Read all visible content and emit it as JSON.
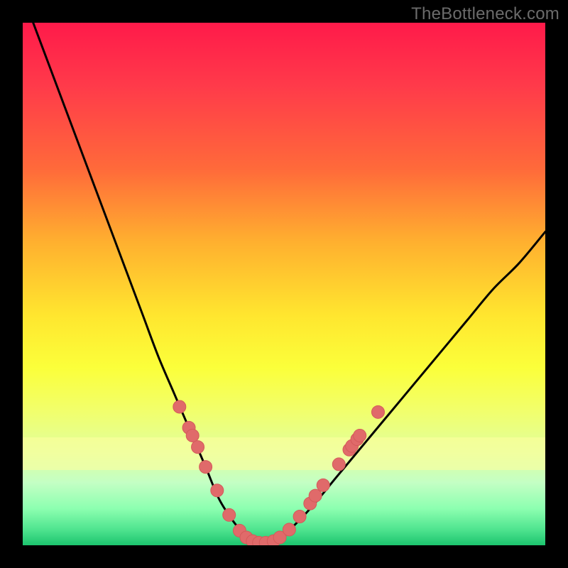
{
  "watermark": "TheBottleneck.com",
  "colors": {
    "curve": "#000000",
    "markers_fill": "#e06a6a",
    "markers_stroke": "#d45a5a",
    "frame_bg": "#000000"
  },
  "chart_data": {
    "type": "line",
    "title": "",
    "xlabel": "",
    "ylabel": "",
    "xlim": [
      0,
      100
    ],
    "ylim": [
      0,
      100
    ],
    "curve": {
      "name": "bottleneck-curve",
      "x": [
        2,
        5,
        8,
        11,
        14,
        17,
        20,
        23,
        26,
        29,
        32,
        35,
        37.5,
        40,
        42.5,
        45,
        47.5,
        50,
        55,
        60,
        65,
        70,
        75,
        80,
        85,
        90,
        95,
        100
      ],
      "y": [
        100,
        92,
        84,
        76,
        68,
        60,
        52,
        44,
        36,
        29,
        22,
        15,
        9,
        5,
        2,
        0.5,
        0.5,
        2,
        7,
        13,
        19,
        25,
        31,
        37,
        43,
        49,
        54,
        60
      ]
    },
    "markers": {
      "name": "data-points",
      "points": [
        {
          "x": 30.0,
          "y": 26.5
        },
        {
          "x": 31.8,
          "y": 22.5
        },
        {
          "x": 32.5,
          "y": 21.0
        },
        {
          "x": 33.5,
          "y": 18.8
        },
        {
          "x": 35.0,
          "y": 15.0
        },
        {
          "x": 37.2,
          "y": 10.5
        },
        {
          "x": 39.5,
          "y": 5.8
        },
        {
          "x": 41.5,
          "y": 2.8
        },
        {
          "x": 42.8,
          "y": 1.5
        },
        {
          "x": 44.0,
          "y": 0.8
        },
        {
          "x": 45.2,
          "y": 0.5
        },
        {
          "x": 46.5,
          "y": 0.5
        },
        {
          "x": 48.0,
          "y": 0.8
        },
        {
          "x": 49.2,
          "y": 1.5
        },
        {
          "x": 51.0,
          "y": 3.0
        },
        {
          "x": 53.0,
          "y": 5.5
        },
        {
          "x": 55.0,
          "y": 8.0
        },
        {
          "x": 56.0,
          "y": 9.5
        },
        {
          "x": 57.5,
          "y": 11.5
        },
        {
          "x": 60.5,
          "y": 15.5
        },
        {
          "x": 62.5,
          "y": 18.3
        },
        {
          "x": 63.0,
          "y": 19.0
        },
        {
          "x": 64.0,
          "y": 20.3
        },
        {
          "x": 64.5,
          "y": 21.0
        },
        {
          "x": 68.0,
          "y": 25.5
        }
      ]
    }
  }
}
